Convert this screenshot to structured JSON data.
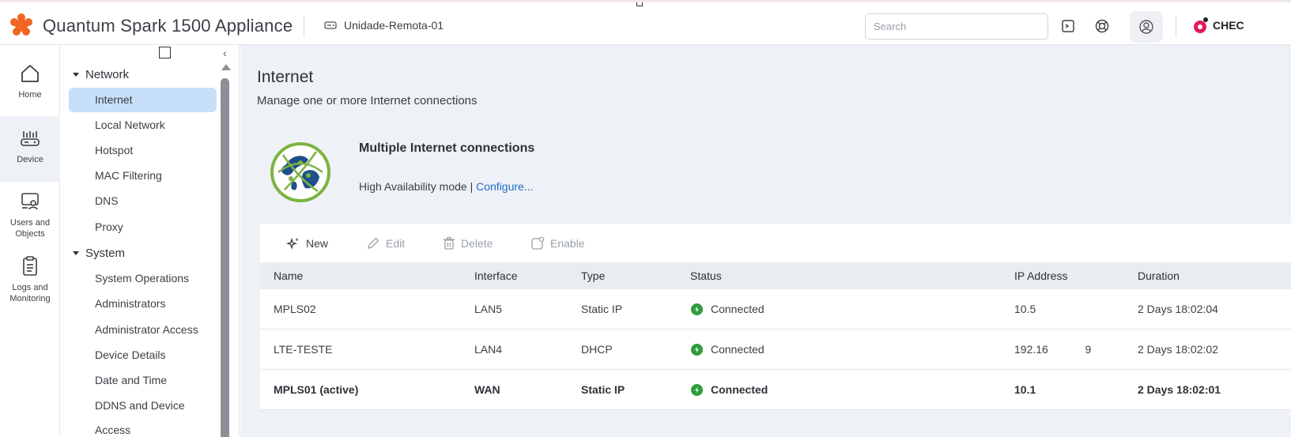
{
  "header": {
    "app_title": "Quantum Spark 1500 Appliance",
    "device_name": "Unidade-Remota-01",
    "search_placeholder": "Search",
    "brand": "CHEC",
    "icons": [
      "terminal-icon",
      "help-icon",
      "user-icon"
    ]
  },
  "rail": {
    "items": [
      {
        "label": "Home",
        "icon": "home-icon"
      },
      {
        "label": "Device",
        "icon": "device-icon"
      },
      {
        "label": "Users and Objects",
        "icon": "users-icon"
      },
      {
        "label": "Logs and Monitoring",
        "icon": "logs-icon"
      }
    ],
    "active": "Device"
  },
  "subnav": {
    "sections": [
      {
        "title": "Network",
        "items": [
          "Internet",
          "Local Network",
          "Hotspot",
          "MAC Filtering",
          "DNS",
          "Proxy"
        ]
      },
      {
        "title": "System",
        "items": [
          "System Operations",
          "Administrators",
          "Administrator Access",
          "Device Details",
          "Date and Time",
          "DDNS and Device Access"
        ]
      }
    ],
    "active": "Internet"
  },
  "main": {
    "title": "Internet",
    "subtitle": "Manage one or more Internet connections",
    "ha_title": "Multiple Internet connections",
    "ha_mode": "High Availability mode | ",
    "ha_link": "Configure..."
  },
  "toolbar": {
    "new": "New",
    "edit": "Edit",
    "delete": "Delete",
    "enable": "Enable"
  },
  "table": {
    "columns": [
      "Name",
      "Interface",
      "Type",
      "Status",
      "IP Address",
      "Duration"
    ],
    "rows": [
      {
        "name": "MPLS02",
        "interface": "LAN5",
        "type": "Static IP",
        "status": "Connected",
        "ip": "10.5",
        "duration": "2 Days 18:02:04",
        "bold": false
      },
      {
        "name": "LTE-TESTE",
        "interface": "LAN4",
        "type": "DHCP",
        "status": "Connected",
        "ip": "192.16            9",
        "duration": "2 Days 18:02:02",
        "bold": false
      },
      {
        "name": "MPLS01 (active)",
        "interface": "WAN",
        "type": "Static IP",
        "status": "Connected",
        "ip": "10.1",
        "duration": "2 Days 18:02:01",
        "bold": true
      }
    ]
  },
  "colors": {
    "accent": "#1f6fc5",
    "active_nav": "#c7dff8",
    "status_ok": "#2e9d3a",
    "content_bg": "#eef1f6"
  }
}
